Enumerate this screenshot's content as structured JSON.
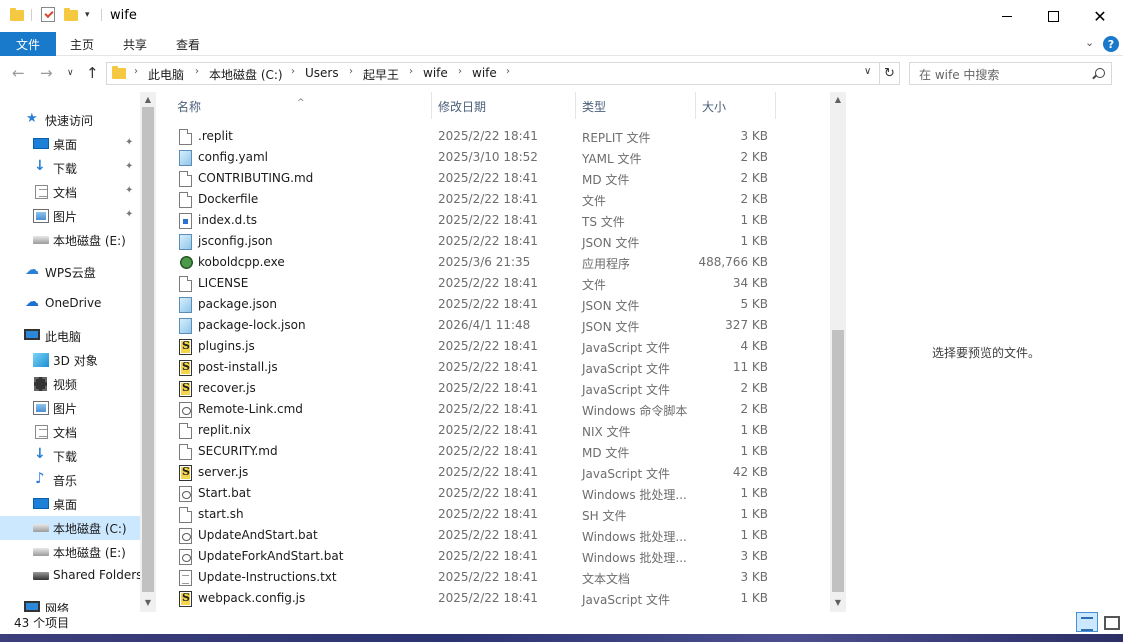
{
  "window": {
    "title": "wife",
    "qa_dropdown": "▾"
  },
  "ribbon": {
    "tabs": [
      "文件",
      "主页",
      "共享",
      "查看"
    ],
    "help": "?"
  },
  "address": {
    "crumbs": [
      "此电脑",
      "本地磁盘 (C:)",
      "Users",
      "起早王",
      "wife",
      "wife"
    ],
    "search_placeholder": "在 wife 中搜索"
  },
  "navpane": {
    "items": [
      {
        "label": "快速访问",
        "icon": "star-icon"
      },
      {
        "label": "桌面",
        "icon": "desktop-icon",
        "pinned": true
      },
      {
        "label": "下载",
        "icon": "download-icon",
        "pinned": true
      },
      {
        "label": "文档",
        "icon": "document-icon",
        "pinned": true
      },
      {
        "label": "图片",
        "icon": "picture-icon",
        "pinned": true
      },
      {
        "label": "本地磁盘 (E:)",
        "icon": "drive-icon"
      },
      {
        "label": "WPS云盘",
        "icon": "cloud-icon"
      },
      {
        "label": "OneDrive",
        "icon": "onedrive-icon"
      },
      {
        "label": "此电脑",
        "icon": "computer-icon"
      },
      {
        "label": "3D 对象",
        "icon": "3d-objects-icon"
      },
      {
        "label": "视频",
        "icon": "video-icon"
      },
      {
        "label": "图片",
        "icon": "picture-icon"
      },
      {
        "label": "文档",
        "icon": "document-icon"
      },
      {
        "label": "下载",
        "icon": "download-icon"
      },
      {
        "label": "音乐",
        "icon": "music-icon"
      },
      {
        "label": "桌面",
        "icon": "desktop-icon"
      },
      {
        "label": "本地磁盘 (C:)",
        "icon": "drive-icon",
        "selected": true
      },
      {
        "label": "本地磁盘 (E:)",
        "icon": "drive-icon"
      },
      {
        "label": "Shared Folders",
        "icon": "network-drive-icon"
      },
      {
        "label": "网络",
        "icon": "network-icon"
      }
    ],
    "pin_glyph": "📌"
  },
  "columns": {
    "name": "名称",
    "date": "修改日期",
    "type": "类型",
    "size": "大小"
  },
  "files": [
    {
      "name": ".replit",
      "date": "2025/2/22 18:41",
      "type": "REPLIT 文件",
      "size": "3 KB",
      "icon": "generic"
    },
    {
      "name": "config.yaml",
      "date": "2025/3/10 18:52",
      "type": "YAML 文件",
      "size": "2 KB",
      "icon": "conf"
    },
    {
      "name": "CONTRIBUTING.md",
      "date": "2025/2/22 18:41",
      "type": "MD 文件",
      "size": "2 KB",
      "icon": "generic"
    },
    {
      "name": "Dockerfile",
      "date": "2025/2/22 18:41",
      "type": "文件",
      "size": "2 KB",
      "icon": "generic"
    },
    {
      "name": "index.d.ts",
      "date": "2025/2/22 18:41",
      "type": "TS 文件",
      "size": "1 KB",
      "icon": "ts"
    },
    {
      "name": "jsconfig.json",
      "date": "2025/2/22 18:41",
      "type": "JSON 文件",
      "size": "1 KB",
      "icon": "conf"
    },
    {
      "name": "koboldcpp.exe",
      "date": "2025/3/6 21:35",
      "type": "应用程序",
      "size": "488,766 KB",
      "icon": "exe"
    },
    {
      "name": "LICENSE",
      "date": "2025/2/22 18:41",
      "type": "文件",
      "size": "34 KB",
      "icon": "generic"
    },
    {
      "name": "package.json",
      "date": "2025/2/22 18:41",
      "type": "JSON 文件",
      "size": "5 KB",
      "icon": "conf"
    },
    {
      "name": "package-lock.json",
      "date": "2026/4/1 11:48",
      "type": "JSON 文件",
      "size": "327 KB",
      "icon": "conf"
    },
    {
      "name": "plugins.js",
      "date": "2025/2/22 18:41",
      "type": "JavaScript 文件",
      "size": "4 KB",
      "icon": "js"
    },
    {
      "name": "post-install.js",
      "date": "2025/2/22 18:41",
      "type": "JavaScript 文件",
      "size": "11 KB",
      "icon": "js"
    },
    {
      "name": "recover.js",
      "date": "2025/2/22 18:41",
      "type": "JavaScript 文件",
      "size": "2 KB",
      "icon": "js"
    },
    {
      "name": "Remote-Link.cmd",
      "date": "2025/2/22 18:41",
      "type": "Windows 命令脚本",
      "size": "2 KB",
      "icon": "cmd"
    },
    {
      "name": "replit.nix",
      "date": "2025/2/22 18:41",
      "type": "NIX 文件",
      "size": "1 KB",
      "icon": "generic"
    },
    {
      "name": "SECURITY.md",
      "date": "2025/2/22 18:41",
      "type": "MD 文件",
      "size": "1 KB",
      "icon": "generic"
    },
    {
      "name": "server.js",
      "date": "2025/2/22 18:41",
      "type": "JavaScript 文件",
      "size": "42 KB",
      "icon": "js"
    },
    {
      "name": "Start.bat",
      "date": "2025/2/22 18:41",
      "type": "Windows 批处理...",
      "size": "1 KB",
      "icon": "cmd"
    },
    {
      "name": "start.sh",
      "date": "2025/2/22 18:41",
      "type": "SH 文件",
      "size": "1 KB",
      "icon": "generic"
    },
    {
      "name": "UpdateAndStart.bat",
      "date": "2025/2/22 18:41",
      "type": "Windows 批处理...",
      "size": "1 KB",
      "icon": "cmd"
    },
    {
      "name": "UpdateForkAndStart.bat",
      "date": "2025/2/22 18:41",
      "type": "Windows 批处理...",
      "size": "3 KB",
      "icon": "cmd"
    },
    {
      "name": "Update-Instructions.txt",
      "date": "2025/2/22 18:41",
      "type": "文本文档",
      "size": "3 KB",
      "icon": "txt"
    },
    {
      "name": "webpack.config.js",
      "date": "2025/2/22 18:41",
      "type": "JavaScript 文件",
      "size": "1 KB",
      "icon": "js"
    }
  ],
  "preview": {
    "empty_text": "选择要预览的文件。"
  },
  "status": {
    "item_count": "43 个项目"
  }
}
